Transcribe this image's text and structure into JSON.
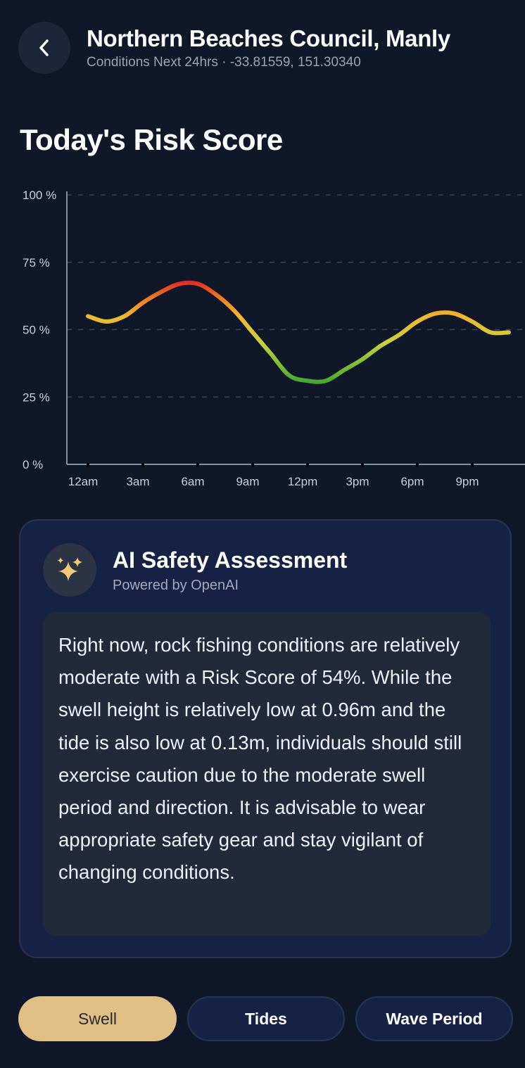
{
  "header": {
    "title": "Northern Beaches Council, Manly",
    "subtitle": "Conditions Next 24hrs · -33.81559, 151.30340"
  },
  "risk_section": {
    "title": "Today's Risk Score"
  },
  "chart_data": {
    "type": "line",
    "title": "",
    "xlabel": "",
    "ylabel": "",
    "ylim": [
      0,
      100
    ],
    "y_ticks": [
      "100 %",
      "75 %",
      "50 %",
      "25 %",
      "0 %"
    ],
    "y_tick_values": [
      100,
      75,
      50,
      25,
      0
    ],
    "x_ticks": [
      "12am",
      "3am",
      "6am",
      "9am",
      "12pm",
      "3pm",
      "6pm",
      "9pm"
    ],
    "x_tick_hours": [
      0,
      3,
      6,
      9,
      12,
      15,
      18,
      21
    ],
    "grid": true,
    "series": [
      {
        "x": [
          0,
          1,
          2,
          3,
          4,
          5,
          6,
          7,
          8,
          9,
          10,
          11,
          12,
          13,
          14,
          15,
          16,
          17,
          18,
          19,
          20,
          21,
          22,
          23
        ],
        "values": [
          55,
          53,
          55,
          60,
          64,
          67,
          67,
          63,
          57,
          49,
          41,
          33,
          31,
          31,
          35,
          39,
          44,
          48,
          53,
          56,
          56,
          53,
          49,
          49
        ]
      }
    ],
    "gradient_stops": [
      {
        "value": 30,
        "color": "#3ea82e"
      },
      {
        "value": 45,
        "color": "#c8d33a"
      },
      {
        "value": 55,
        "color": "#f2b729"
      },
      {
        "value": 62,
        "color": "#f07a1e"
      },
      {
        "value": 68,
        "color": "#e3271d"
      }
    ]
  },
  "assessment": {
    "title": "AI Safety Assessment",
    "subtitle": "Powered by OpenAI",
    "icon": "sparkles-icon",
    "text": "Right now, rock fishing conditions are relatively moderate with a Risk Score of 54%. While the swell height is relatively low at 0.96m and the tide is also low at 0.13m, individuals should still exercise caution due to the moderate swell period and direction. It is advisable to wear appropriate safety gear and stay vigilant of changing conditions."
  },
  "tabs": {
    "swell": "Swell",
    "tides": "Tides",
    "wave_period": "Wave Period",
    "active": "Swell"
  },
  "colors": {
    "background": "#0f1729",
    "card": "#152243",
    "accent": "#dfbf86"
  }
}
